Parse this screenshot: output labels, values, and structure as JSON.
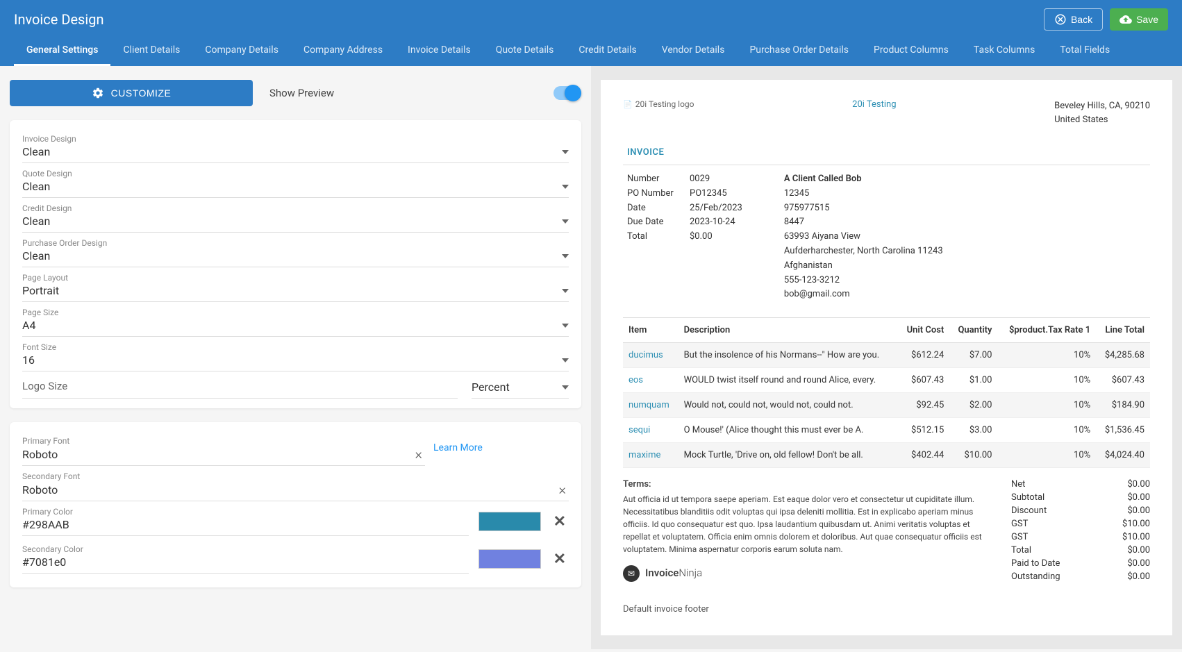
{
  "header": {
    "title": "Invoice Design",
    "back": "Back",
    "save": "Save"
  },
  "tabs": [
    "General Settings",
    "Client Details",
    "Company Details",
    "Company Address",
    "Invoice Details",
    "Quote Details",
    "Credit Details",
    "Vendor Details",
    "Purchase Order Details",
    "Product Columns",
    "Task Columns",
    "Total Fields"
  ],
  "customize": {
    "button": "CUSTOMIZE",
    "show_preview": "Show Preview"
  },
  "designs": {
    "invoice": {
      "label": "Invoice Design",
      "value": "Clean"
    },
    "quote": {
      "label": "Quote Design",
      "value": "Clean"
    },
    "credit": {
      "label": "Credit Design",
      "value": "Clean"
    },
    "po": {
      "label": "Purchase Order Design",
      "value": "Clean"
    },
    "page_layout": {
      "label": "Page Layout",
      "value": "Portrait"
    },
    "page_size": {
      "label": "Page Size",
      "value": "A4"
    },
    "font_size": {
      "label": "Font Size",
      "value": "16"
    },
    "logo_size": {
      "label": "Logo Size",
      "value": "Percent"
    }
  },
  "fonts": {
    "primary": {
      "label": "Primary Font",
      "value": "Roboto"
    },
    "secondary": {
      "label": "Secondary Font",
      "value": "Roboto"
    },
    "learn_more": "Learn More",
    "primary_color": {
      "label": "Primary Color",
      "value": "#298AAB",
      "swatch": "#298AAB"
    },
    "secondary_color": {
      "label": "Secondary Color",
      "value": "#7081e0",
      "swatch": "#7081e0"
    }
  },
  "invoice": {
    "logo_alt": "20i Testing logo",
    "company": "20i Testing",
    "address1": "Beveley Hills, CA, 90210",
    "address2": "United States",
    "title": "INVOICE",
    "meta": {
      "number_lbl": "Number",
      "number": "0029",
      "po_lbl": "PO Number",
      "po": "PO12345",
      "date_lbl": "Date",
      "date": "25/Feb/2023",
      "due_lbl": "Due Date",
      "due": "2023-10-24",
      "total_lbl": "Total",
      "total": "$0.00"
    },
    "client": {
      "name": "A Client Called Bob",
      "l1": "12345",
      "l2": "975977515",
      "l3": "8447",
      "l4": "63993 Aiyana View",
      "l5": "Aufderharchester, North Carolina 11243",
      "l6": "Afghanistan",
      "l7": "555-123-3212",
      "l8": "bob@gmail.com"
    },
    "columns": [
      "Item",
      "Description",
      "Unit Cost",
      "Quantity",
      "$product.Tax Rate 1",
      "Line Total"
    ],
    "rows": [
      {
        "item": "ducimus",
        "desc": "But the insolence of his Normans--\" How are you.",
        "cost": "$612.24",
        "qty": "$7.00",
        "tax": "10%",
        "total": "$4,285.68"
      },
      {
        "item": "eos",
        "desc": "WOULD twist itself round and round Alice, every.",
        "cost": "$607.43",
        "qty": "$1.00",
        "tax": "10%",
        "total": "$607.43"
      },
      {
        "item": "numquam",
        "desc": "Would not, could not, would not, could not.",
        "cost": "$92.45",
        "qty": "$2.00",
        "tax": "10%",
        "total": "$184.90"
      },
      {
        "item": "sequi",
        "desc": "O Mouse!' (Alice thought this must ever be A.",
        "cost": "$512.15",
        "qty": "$3.00",
        "tax": "10%",
        "total": "$1,536.45"
      },
      {
        "item": "maxime",
        "desc": "Mock Turtle, 'Drive on, old fellow! Don't be all.",
        "cost": "$402.44",
        "qty": "$10.00",
        "tax": "10%",
        "total": "$4,024.40"
      }
    ],
    "terms_title": "Terms:",
    "terms": "Aut officia id ut tempora saepe aperiam. Est eaque dolor vero et consectetur ut cupiditate illum. Necessitatibus blanditiis odit voluptas qui ipsa deleniti mollitia. Est in explicabo aperiam minus officiis. Id quo consequatur est quo. Ipsa laudantium quibusdam ut. Animi veritatis voluptas et repellat et voluptatem. Officia enim omnis dolorem et doloribus. Aut quae consequatur officiis est voluptatem. Minima aspernatur corporis earum soluta nam.",
    "totals": [
      {
        "label": "Net",
        "value": "$0.00"
      },
      {
        "label": "Subtotal",
        "value": "$0.00"
      },
      {
        "label": "Discount",
        "value": "$0.00"
      },
      {
        "label": "GST",
        "value": "$10.00"
      },
      {
        "label": "GST",
        "value": "$10.00"
      },
      {
        "label": "Total",
        "value": "$0.00"
      },
      {
        "label": "Paid to Date",
        "value": "$0.00"
      },
      {
        "label": "Outstanding",
        "value": "$0.00"
      }
    ],
    "brand": "InvoiceNinja",
    "footer": "Default invoice footer"
  }
}
